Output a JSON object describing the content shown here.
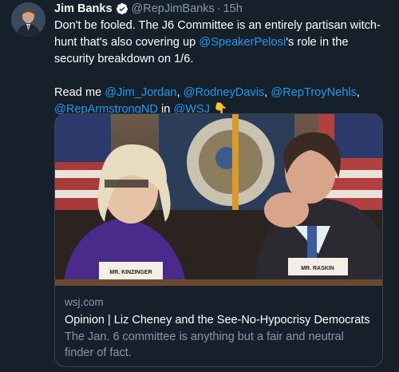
{
  "author": {
    "name": "Jim Banks",
    "handle": "@RepJimBanks",
    "separator": "·",
    "time": "15h"
  },
  "tweet": {
    "line1_text": "Don't be fooled. The J6 Committee is an entirely partisan witch-hunt that's also covering up ",
    "line1_mention": "@SpeakerPelosi",
    "line1_tail": "'s role in the security breakdown on 1/6.",
    "read_me": "Read me ",
    "mentions": [
      "@Jim_Jordan",
      "@RodneyDavis",
      "@RepTroyNehls",
      "@RepArmstrongND"
    ],
    "comma": ", ",
    "in_text": " in ",
    "wsj_mention": "@WSJ",
    "emoji": "👇"
  },
  "card": {
    "domain": "wsj.com",
    "headline": "Opinion | Liz Cheney and the See-No-Hypocrisy Democrats",
    "description": "The Jan. 6 committee is anything but a fair and neutral finder of fact.",
    "placard_left": "MR. KINZINGER",
    "placard_right": "MR. RASKIN"
  },
  "colors": {
    "background": "#15202b",
    "link": "#1d9bf0",
    "secondary": "#8b98a5",
    "verified": "#ffffff"
  },
  "icons": {
    "verified": "verified-badge-icon",
    "pointing_down": "backhand-index-pointing-down-emoji"
  }
}
